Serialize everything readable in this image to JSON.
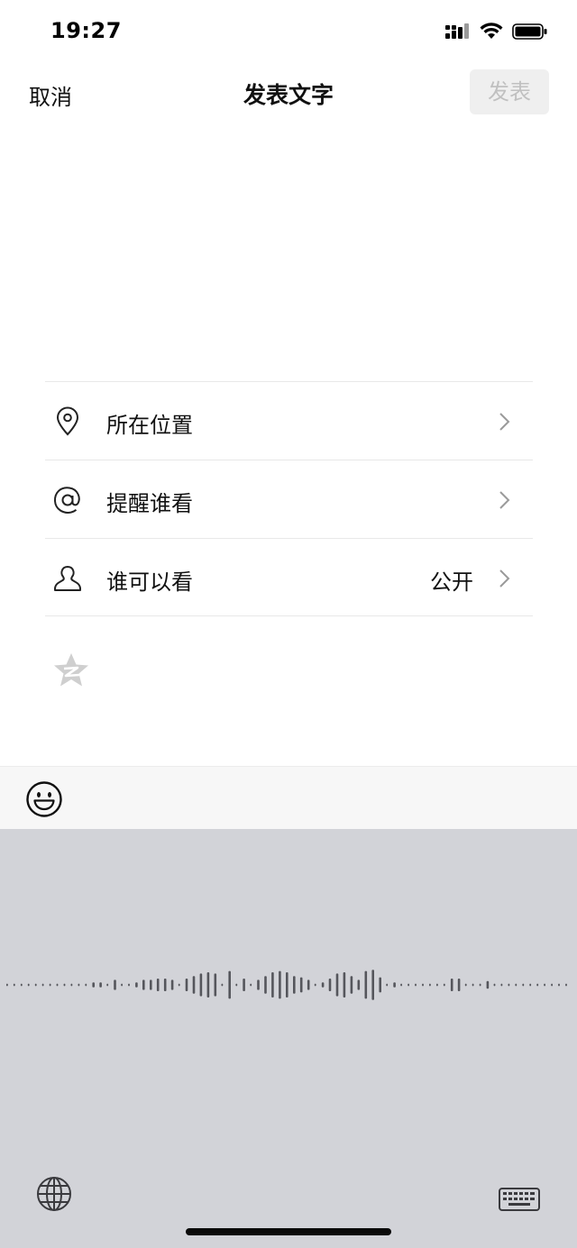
{
  "status_bar": {
    "time": "19:27",
    "icons": [
      "cellular-signal-icon",
      "wifi-icon",
      "battery-icon"
    ]
  },
  "nav": {
    "cancel_label": "取消",
    "title": "发表文字",
    "post_label": "发表"
  },
  "options": [
    {
      "label": "所在位置",
      "icon": "location-pin-icon",
      "value": ""
    },
    {
      "label": "提醒谁看",
      "icon": "at-sign-icon",
      "value": ""
    },
    {
      "label": "谁可以看",
      "icon": "person-icon",
      "value": "公开"
    }
  ],
  "extras": {
    "qzone_icon": "qzone-star-icon"
  },
  "toolbar": {
    "emoji_icon": "smiley-face-icon"
  },
  "keyboard": {
    "mode": "voice-dictation",
    "left_icon": "globe-icon",
    "right_icon": "keyboard-icon"
  },
  "colors": {
    "post_button_bg": "#efefef",
    "post_button_text": "#c0c0c0",
    "keyboard_bg": "#d2d3d8",
    "toolbar_bg": "#f7f7f7",
    "waveform": "#55565c"
  }
}
